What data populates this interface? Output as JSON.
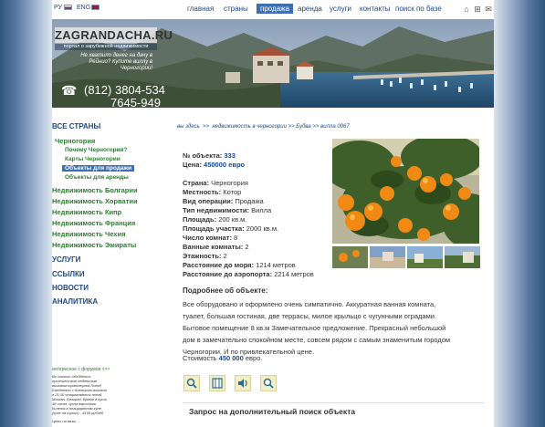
{
  "lang": {
    "ru": "РУ",
    "eng": "ENG"
  },
  "nav": [
    "главная",
    "страны",
    "продажа",
    "аренда",
    "услуги",
    "контакты",
    "поиск по базе"
  ],
  "nav_active": "продажа",
  "top_icons": [
    "home-icon",
    "sitemap-icon",
    "mail-icon"
  ],
  "banner": {
    "logo": "ZAGRANDACHA.RU",
    "tagline": "портал о зарубежной недвижимости",
    "teaser": "Не хватило денег на дачу в Рейнио? Купите виллу в Черногории!",
    "phone1": "(812) 3804-534",
    "phone2": "7645-949"
  },
  "sidebar": {
    "all_countries": "ВСЕ СТРАНЫ",
    "montenegro": "Черногория",
    "sub": [
      "Почему Черногория?",
      "Карты Черногории",
      "Объекты для продажи",
      "Объекты для аренды"
    ],
    "countries": [
      "Недвижимость Болгарии",
      "Недвижимость Хорватии",
      "Недвижимость Кипр",
      "Недвижимость Франция",
      "Недвижимость Чехия",
      "Недвижимость Эмираты"
    ],
    "sections": [
      "УСЛУГИ",
      "ССЫЛКИ",
      "НОВОСТИ",
      "АНАЛИТИКА"
    ],
    "forum_head": "интересное с форумов >>>",
    "forum_text": "Во сколько обойдется путешествие недельным вызовом транспорта Поезд Ежедневно с Киевского вокзала в 21:30 отправляется поезд Москва- Белград. Время в пути 48 часов. Цена взрослого билета в плацкартном купе (купе на троих) - 4150 рублей",
    "forum_foot": "Цены на визы ..."
  },
  "breadcrumb": [
    "вы здесь",
    "недвижимость в черногории",
    "Будва",
    "вилла 0067"
  ],
  "property": {
    "id_label": "№ объекта:",
    "id_value": "333",
    "price_label": "Цена:",
    "price_value": "450000 евро",
    "rows": [
      {
        "label": "Страна:",
        "value": "Черногория"
      },
      {
        "label": "Местность:",
        "value": "Котор"
      },
      {
        "label": "Вид операции:",
        "value": "Продажа"
      },
      {
        "label": "Тип недвижимости:",
        "value": "Вилла"
      },
      {
        "label": "Площадь:",
        "value": "200 кв.м."
      },
      {
        "label": "Площадь участка:",
        "value": "2000 кв.м."
      },
      {
        "label": "Число комнат:",
        "value": "8"
      },
      {
        "label": "Ванные комнаты:",
        "value": "2"
      },
      {
        "label": "Этажность:",
        "value": "2"
      },
      {
        "label": "Расстояние до моря:",
        "value": "1214 метров"
      },
      {
        "label": "Расстояние до аэропорта:",
        "value": "2214 метров"
      }
    ]
  },
  "details": {
    "title": "Подробнее об объекте:",
    "lines": [
      "Все оборудовано и оформлено очень симпатично. Аккуратная ванная  комната,",
      "туалет, большая гостиная, две террасы, милое крыльцо с  чугунными оградами.",
      "Бытовое помещение 8 кв.м Замечательное  предложение.  Прекрасный небольшой",
      "дом в замечательно спокойном месте, совсем рядом с самым знаменитым городом",
      "Черногории. И по привлекательной цене."
    ],
    "price_prefix": "Стоимость",
    "price_value": "450 000",
    "price_suffix": "евро."
  },
  "tools": [
    "zoom-icon",
    "map-icon",
    "audio-icon",
    "search-icon"
  ],
  "request_title": "Запрос на дополнительный поиск объекта"
}
